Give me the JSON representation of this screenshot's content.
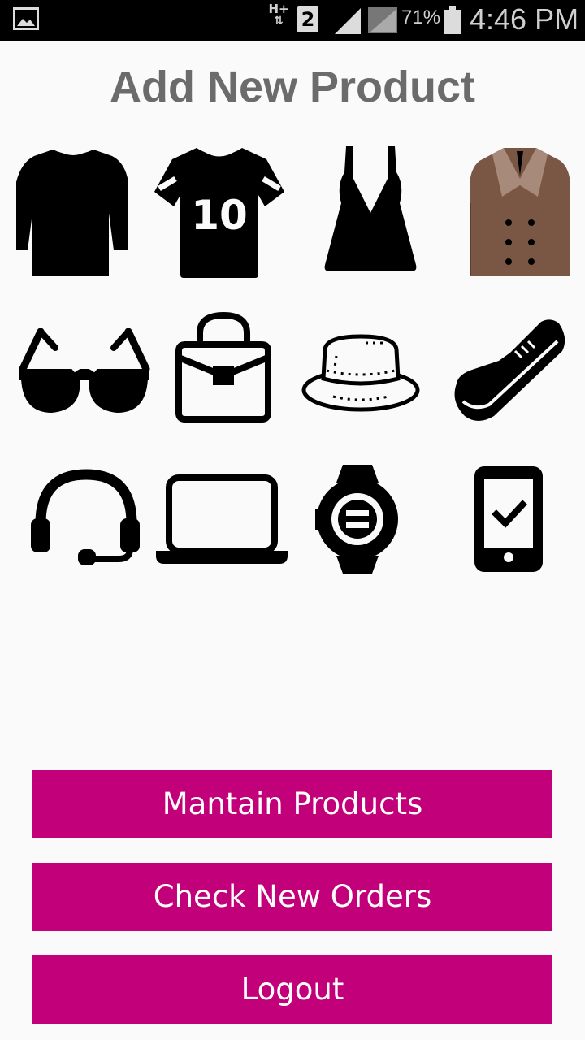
{
  "status_bar": {
    "network_type": "H+",
    "sim_slot": "2",
    "battery_percent": "71%",
    "time": "4:46 PM"
  },
  "page": {
    "title": "Add New Product"
  },
  "categories": {
    "icons": [
      "long-sleeve-shirt-icon",
      "jersey-icon",
      "dress-icon",
      "coat-icon",
      "sunglasses-icon",
      "handbag-icon",
      "hat-icon",
      "sneaker-icon",
      "headset-icon",
      "laptop-icon",
      "smartwatch-icon",
      "smartphone-icon"
    ],
    "jersey_number": "10"
  },
  "actions": {
    "maintain_products": "Mantain Products",
    "check_new_orders": "Check New Orders",
    "logout": "Logout"
  },
  "colors": {
    "button_bg": "#c2007a",
    "button_text": "#ffffff",
    "title": "#6b6b6b",
    "coat": "#7a5645",
    "coat_collar": "#a88a7a",
    "background": "#fafafa"
  }
}
